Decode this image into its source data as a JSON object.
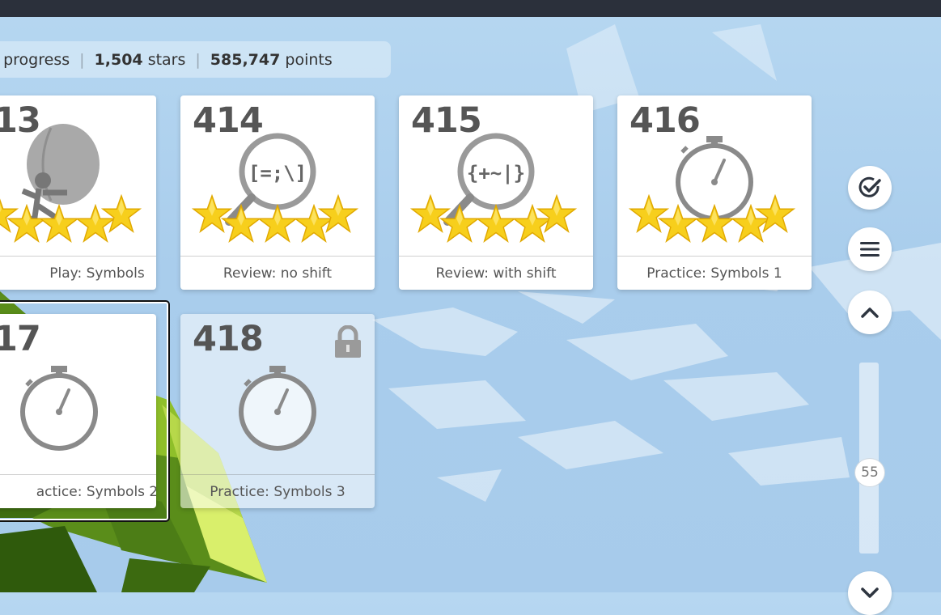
{
  "stats": {
    "progress_suffix": "% progress",
    "stars_value": "1,504",
    "stars_label": "stars",
    "points_value": "585,747",
    "points_label": "points",
    "separator": "|"
  },
  "lessons": [
    {
      "number": "13",
      "title": "Play: Symbols",
      "stars": 5,
      "icon": "balloon-ninja-icon",
      "locked": false
    },
    {
      "number": "414",
      "title": "Review: no shift",
      "stars": 5,
      "icon": "magnifier-icon",
      "glyphs": "[=;\\]",
      "locked": false
    },
    {
      "number": "415",
      "title": "Review: with shift",
      "stars": 5,
      "icon": "magnifier-icon",
      "glyphs": "{+~|}",
      "locked": false
    },
    {
      "number": "416",
      "title": "Practice: Symbols 1",
      "stars": 5,
      "icon": "stopwatch-icon",
      "locked": false
    },
    {
      "number": "17",
      "title": "actice: Symbols 2",
      "stars": 0,
      "icon": "stopwatch-icon",
      "locked": false,
      "selected": true
    },
    {
      "number": "418",
      "title": "Practice: Symbols 3",
      "stars": 0,
      "icon": "stopwatch-icon",
      "locked": true
    }
  ],
  "sidebar": {
    "buttons": [
      "check-circle-icon",
      "menu-icon",
      "chevron-up-icon",
      "chevron-down-icon"
    ],
    "slider_value": "55"
  },
  "colors": {
    "star": "#f7cf1c",
    "icon_gray": "#8a8a8a",
    "number": "#555555",
    "topbar": "#2b303b"
  }
}
